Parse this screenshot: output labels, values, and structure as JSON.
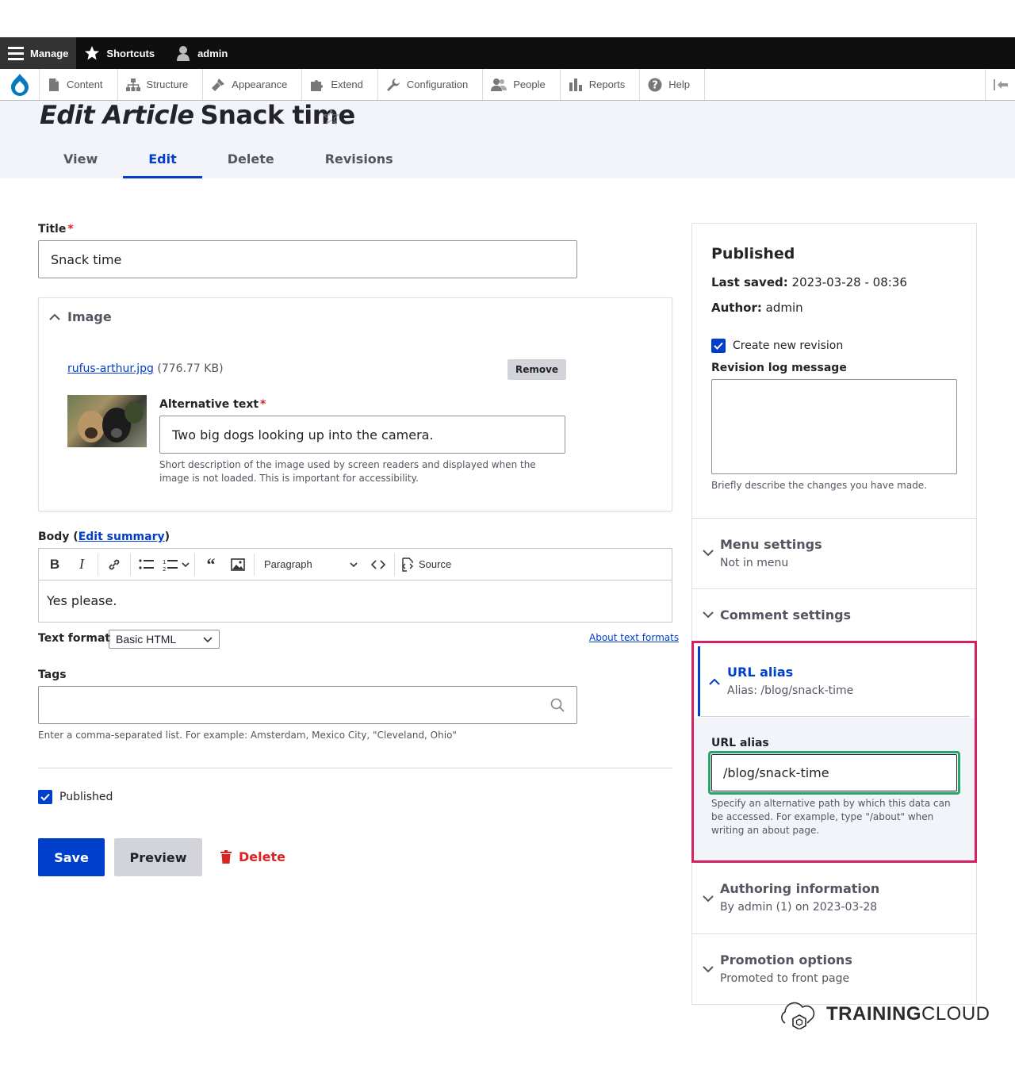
{
  "toolbar": {
    "manage": "Manage",
    "shortcuts": "Shortcuts",
    "user": "admin"
  },
  "tray": {
    "items": [
      {
        "label": "Content",
        "icon": "file-icon"
      },
      {
        "label": "Structure",
        "icon": "sitemap-icon"
      },
      {
        "label": "Appearance",
        "icon": "paintbrush-icon"
      },
      {
        "label": "Extend",
        "icon": "puzzle-icon"
      },
      {
        "label": "Configuration",
        "icon": "wrench-icon"
      },
      {
        "label": "People",
        "icon": "people-icon"
      },
      {
        "label": "Reports",
        "icon": "bar-chart-icon"
      },
      {
        "label": "Help",
        "icon": "question-icon"
      }
    ]
  },
  "page": {
    "title_prefix": "Edit Article",
    "title_main": "Snack time"
  },
  "tabs": [
    "View",
    "Edit",
    "Delete",
    "Revisions"
  ],
  "form": {
    "title_label": "Title",
    "title_value": "Snack time",
    "image_label": "Image",
    "file_link": "rufus-arthur.jpg",
    "file_size": "(776.77 KB)",
    "remove": "Remove",
    "alt_label": "Alternative text",
    "alt_value": "Two big dogs looking up into the camera.",
    "alt_desc": "Short description of the image used by screen readers and displayed when the image is not loaded. This is important for accessibility.",
    "body_label": "Body (",
    "edit_summary": "Edit summary",
    "body_close": ")",
    "paragraph": "Paragraph",
    "source": "Source",
    "body_value": "Yes please.",
    "text_format_label": "Text format",
    "text_format_value": "Basic HTML",
    "about_formats": "About text formats",
    "tags_label": "Tags",
    "tags_desc": "Enter a comma-separated list. For example: Amsterdam, Mexico City, \"Cleveland, Ohio\"",
    "published_label": "Published",
    "save": "Save",
    "preview": "Preview",
    "delete": "Delete"
  },
  "sidebar": {
    "status": "Published",
    "last_saved_label": "Last saved:",
    "last_saved_value": "2023-03-28 - 08:36",
    "author_label": "Author:",
    "author_value": "admin",
    "create_revision": "Create new revision",
    "revision_log_label": "Revision log message",
    "revision_desc": "Briefly describe the changes you have made.",
    "menu_title": "Menu settings",
    "menu_sub": "Not in menu",
    "comment_title": "Comment settings",
    "url_title": "URL alias",
    "url_sub": "Alias: /blog/snack-time",
    "url_field_label": "URL alias",
    "url_value": "/blog/snack-time",
    "url_desc": "Specify an alternative path by which this data can be accessed. For example, type \"/about\" when writing an about page.",
    "authoring_title": "Authoring information",
    "authoring_sub": "By admin (1) on 2023-03-28",
    "promotion_title": "Promotion options",
    "promotion_sub": "Promoted to front page"
  },
  "watermark": {
    "bold": "TRAINING",
    "light": "CLOUD"
  }
}
